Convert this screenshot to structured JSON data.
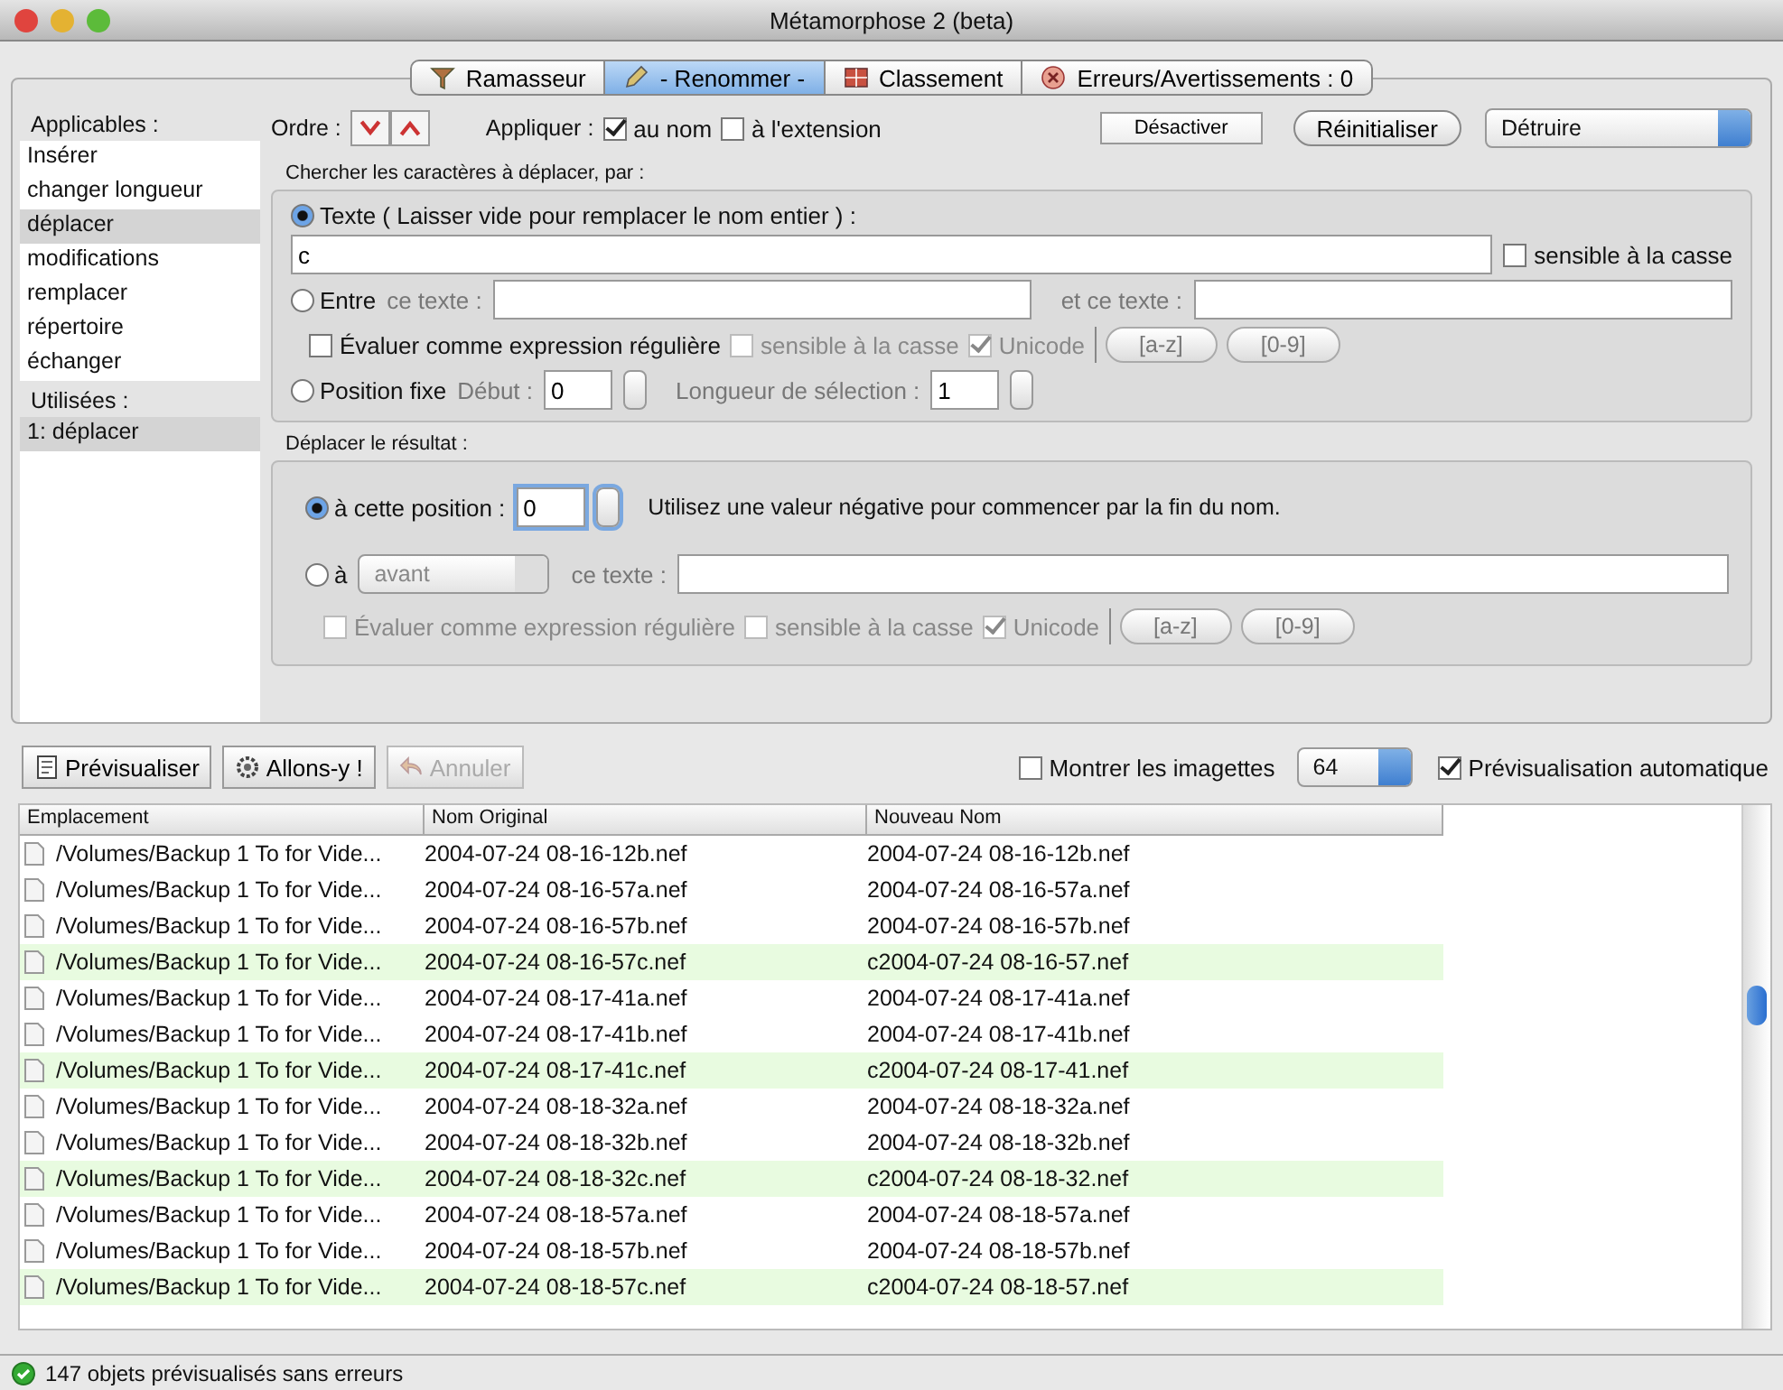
{
  "window": {
    "title": "Métamorphose 2 (beta)"
  },
  "tabs": [
    {
      "label": "Ramasseur",
      "selected": false
    },
    {
      "label": "- Renommer -",
      "selected": true
    },
    {
      "label": "Classement",
      "selected": false
    },
    {
      "label": "Erreurs/Avertissements : 0",
      "selected": false
    }
  ],
  "sidebar": {
    "applicables_label": "Applicables :",
    "applicables": [
      {
        "label": "Insérer",
        "selected": false
      },
      {
        "label": "changer longueur",
        "selected": false
      },
      {
        "label": "déplacer",
        "selected": true
      },
      {
        "label": "modifications",
        "selected": false
      },
      {
        "label": "remplacer",
        "selected": false
      },
      {
        "label": "répertoire",
        "selected": false
      },
      {
        "label": "échanger",
        "selected": false
      }
    ],
    "used_label": "Utilisées :",
    "used": [
      {
        "label": "1: déplacer",
        "selected": true
      }
    ]
  },
  "top_bar": {
    "order_label": "Ordre :",
    "apply_label": "Appliquer :",
    "apply_options": [
      {
        "label": "au nom",
        "checked": true
      },
      {
        "label": "à l'extension",
        "checked": false
      }
    ],
    "disable_button": "Désactiver",
    "reset_button": "Réinitialiser",
    "action_dropdown": "Détruire"
  },
  "search_section": {
    "title": "Chercher les caractères à déplacer, par :",
    "text_option": {
      "label": "Texte ( Laisser vide pour remplacer le nom entier ) :",
      "selected": true,
      "value": "c",
      "case": {
        "label": "sensible à la casse",
        "checked": false
      }
    },
    "between_option": {
      "label": "Entre",
      "selected": false,
      "first_label": "ce texte :",
      "second_label": "et ce texte :"
    },
    "checks": [
      {
        "label": "Évaluer comme expression régulière",
        "checked": false,
        "disabled": false
      },
      {
        "label": "sensible à la casse",
        "checked": false,
        "disabled": true
      },
      {
        "label": "Unicode",
        "checked": true,
        "disabled": true
      }
    ],
    "buttons": [
      "[a-z]",
      "[0-9]"
    ],
    "fixed_option": {
      "label": "Position fixe",
      "selected": false,
      "start_label": "Début :",
      "start_value": "0",
      "length_label": "Longueur de sélection :",
      "length_value": "1"
    }
  },
  "move_section": {
    "title": "Déplacer le résultat :",
    "position_option": {
      "label": "à cette position :",
      "selected": true,
      "value": "0",
      "hint": "Utilisez une valeur négative pour commencer par la fin du nom."
    },
    "text_option": {
      "label": "à",
      "selected": false,
      "dropdown": "avant",
      "field_label": "ce texte :"
    },
    "checks": [
      {
        "label": "Évaluer comme expression régulière",
        "checked": false,
        "disabled": true
      },
      {
        "label": "sensible à la casse",
        "checked": false,
        "disabled": true
      },
      {
        "label": "Unicode",
        "checked": true,
        "disabled": true
      }
    ],
    "buttons": [
      "[a-z]",
      "[0-9]"
    ]
  },
  "toolbar": {
    "buttons": [
      {
        "label": "Prévisualiser",
        "disabled": false
      },
      {
        "label": "Allons-y !",
        "disabled": false
      },
      {
        "label": "Annuler",
        "disabled": true
      }
    ],
    "thumbnails": {
      "label": "Montrer les imagettes",
      "checked": false
    },
    "size": "64",
    "auto_preview": {
      "label": "Prévisualisation automatique",
      "checked": true
    }
  },
  "table": {
    "columns": [
      "Emplacement",
      "Nom Original",
      "Nouveau Nom"
    ],
    "rows": [
      {
        "location": "/Volumes/Backup 1 To for Vide...",
        "original": "2004-07-24 08-16-12b.nef",
        "new": "2004-07-24 08-16-12b.nef",
        "changed": false
      },
      {
        "location": "/Volumes/Backup 1 To for Vide...",
        "original": "2004-07-24 08-16-57a.nef",
        "new": "2004-07-24 08-16-57a.nef",
        "changed": false
      },
      {
        "location": "/Volumes/Backup 1 To for Vide...",
        "original": "2004-07-24 08-16-57b.nef",
        "new": "2004-07-24 08-16-57b.nef",
        "changed": false
      },
      {
        "location": "/Volumes/Backup 1 To for Vide...",
        "original": "2004-07-24 08-16-57c.nef",
        "new": "c2004-07-24 08-16-57.nef",
        "changed": true
      },
      {
        "location": "/Volumes/Backup 1 To for Vide...",
        "original": "2004-07-24 08-17-41a.nef",
        "new": "2004-07-24 08-17-41a.nef",
        "changed": false
      },
      {
        "location": "/Volumes/Backup 1 To for Vide...",
        "original": "2004-07-24 08-17-41b.nef",
        "new": "2004-07-24 08-17-41b.nef",
        "changed": false
      },
      {
        "location": "/Volumes/Backup 1 To for Vide...",
        "original": "2004-07-24 08-17-41c.nef",
        "new": "c2004-07-24 08-17-41.nef",
        "changed": true
      },
      {
        "location": "/Volumes/Backup 1 To for Vide...",
        "original": "2004-07-24 08-18-32a.nef",
        "new": "2004-07-24 08-18-32a.nef",
        "changed": false
      },
      {
        "location": "/Volumes/Backup 1 To for Vide...",
        "original": "2004-07-24 08-18-32b.nef",
        "new": "2004-07-24 08-18-32b.nef",
        "changed": false
      },
      {
        "location": "/Volumes/Backup 1 To for Vide...",
        "original": "2004-07-24 08-18-32c.nef",
        "new": "c2004-07-24 08-18-32.nef",
        "changed": true
      },
      {
        "location": "/Volumes/Backup 1 To for Vide...",
        "original": "2004-07-24 08-18-57a.nef",
        "new": "2004-07-24 08-18-57a.nef",
        "changed": false
      },
      {
        "location": "/Volumes/Backup 1 To for Vide...",
        "original": "2004-07-24 08-18-57b.nef",
        "new": "2004-07-24 08-18-57b.nef",
        "changed": false
      },
      {
        "location": "/Volumes/Backup 1 To for Vide...",
        "original": "2004-07-24 08-18-57c.nef",
        "new": "c2004-07-24 08-18-57.nef",
        "changed": true
      }
    ]
  },
  "status_bar": {
    "text": "147 objets prévisualisés sans erreurs"
  }
}
